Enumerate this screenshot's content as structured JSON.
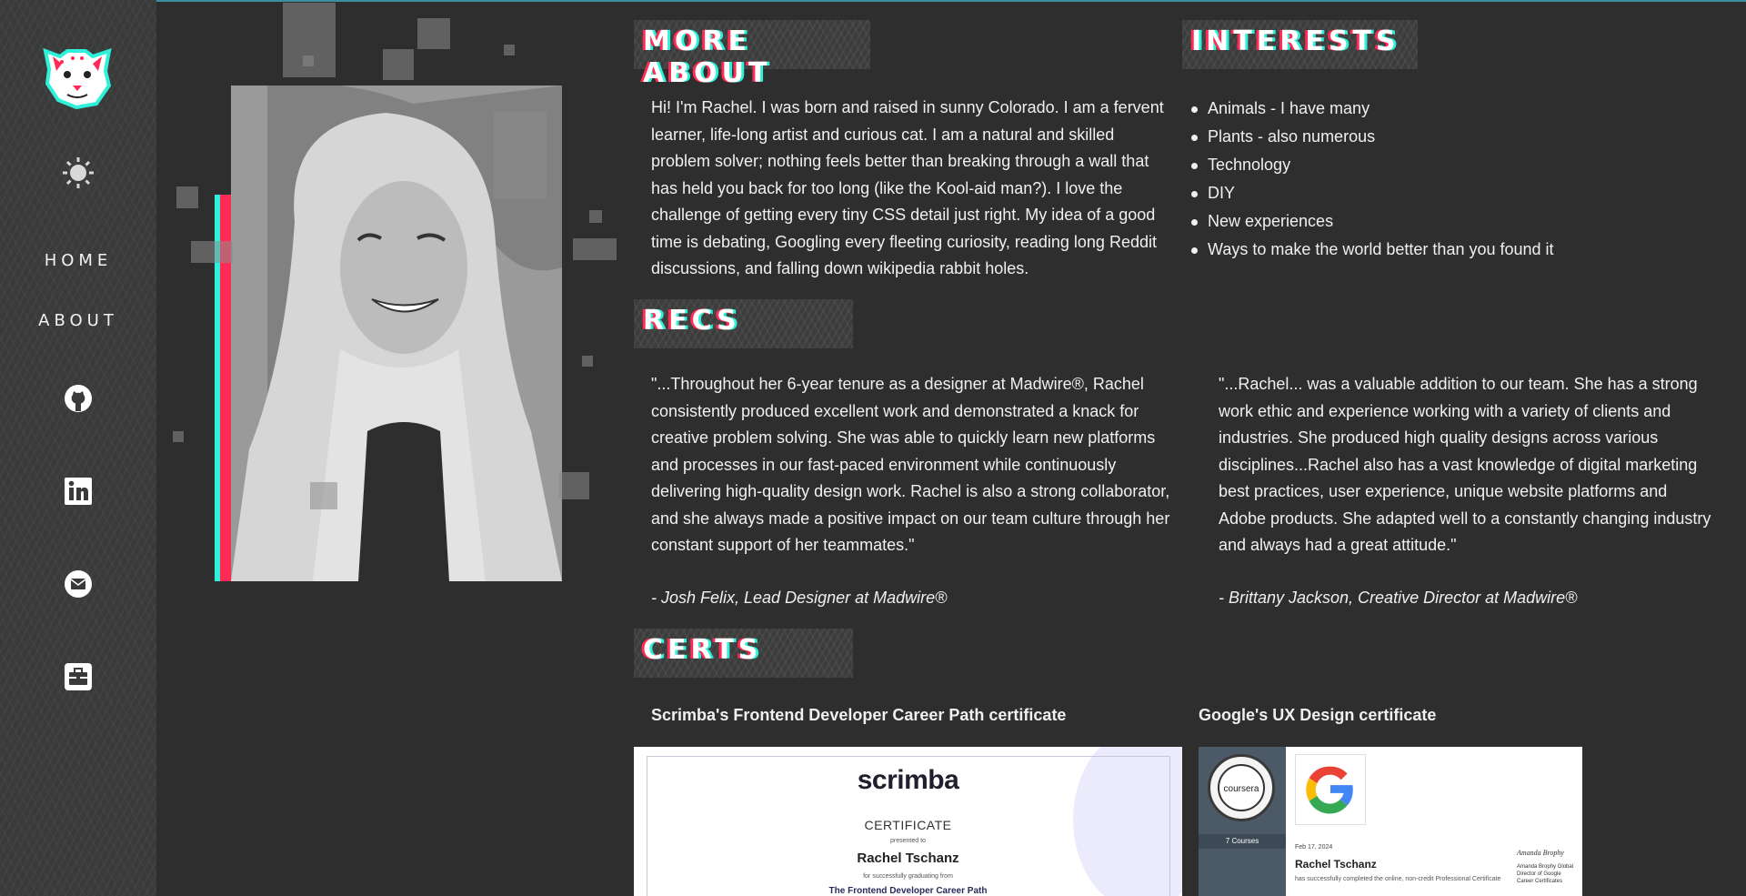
{
  "nav": {
    "home_label": "HOME",
    "about_label": "ABOUT",
    "icons": [
      "logo-cat-icon",
      "sun-icon",
      "github-icon",
      "linkedin-icon",
      "mail-icon",
      "briefcase-icon"
    ]
  },
  "about": {
    "heading": "MORE ABOUT",
    "paragraph": "Hi! I'm Rachel. I was born and raised in sunny Colorado. I am a fervent learner, life-long artist and curious cat. I am a natural and skilled problem solver; nothing feels better than breaking through a wall that has held you back for too long (like the Kool-aid man?). I love the challenge of getting every tiny CSS detail just right. My idea of a good time is debating, Googling every fleeting curiosity, reading long Reddit discussions, and falling down wikipedia rabbit holes."
  },
  "interests": {
    "heading": "INTERESTS",
    "items": [
      "Animals - I have many",
      "Plants - also numerous",
      "Technology",
      "DIY",
      "New experiences",
      "Ways to make the world better than you found it"
    ]
  },
  "recs": {
    "heading": "RECS",
    "items": [
      {
        "quote": "\"...Throughout her 6-year tenure as a designer at Madwire®, Rachel consistently produced excellent work and demonstrated a knack for creative problem solving. She was able to quickly learn new platforms and processes in our fast-paced environment while continuously delivering high-quality design work. Rachel is also a strong collaborator, and she always made a positive impact on our team culture through her constant support of her teammates.\"",
        "author": "- Josh Felix, Lead Designer at Madwire®"
      },
      {
        "quote": "\"...Rachel... was a valuable addition to our team. She has a strong work ethic and experience working with a variety of clients and industries. She produced high quality designs across various disciplines...Rachel also has a vast knowledge of digital marketing best practices, user experience, unique website platforms and Adobe products. She adapted well to a constantly changing industry and always had a great attitude.\"",
        "author": "- Brittany Jackson, Creative Director at Madwire®"
      }
    ]
  },
  "certs": {
    "heading": "CERTS",
    "scrimba": {
      "label": "Scrimba's Frontend Developer Career Path certificate",
      "logo_text": "scrimba",
      "cert_word": "CERTIFICATE",
      "presented_to": "presented to",
      "name": "Rachel Tschanz",
      "graduating": "for successfully graduating from",
      "path": "The Frontend Developer Career Path"
    },
    "google": {
      "label": "Google's UX Design certificate",
      "seal_text": "coursera",
      "courses": "7 Courses",
      "date": "Feb 17, 2024",
      "name": "Rachel Tschanz",
      "desc": "has successfully completed the online, non-credit Professional Certificate",
      "signature": "Amanda Brophy",
      "signer": "Amanda Brophy Global Director of Google Career Certificates"
    }
  },
  "colors": {
    "background": "#2e2e2e",
    "sidebar": "#3a3a3a",
    "glitch_red": "#ff2a55",
    "glitch_teal": "#2ff0d8",
    "text": "#f0f0f0"
  }
}
